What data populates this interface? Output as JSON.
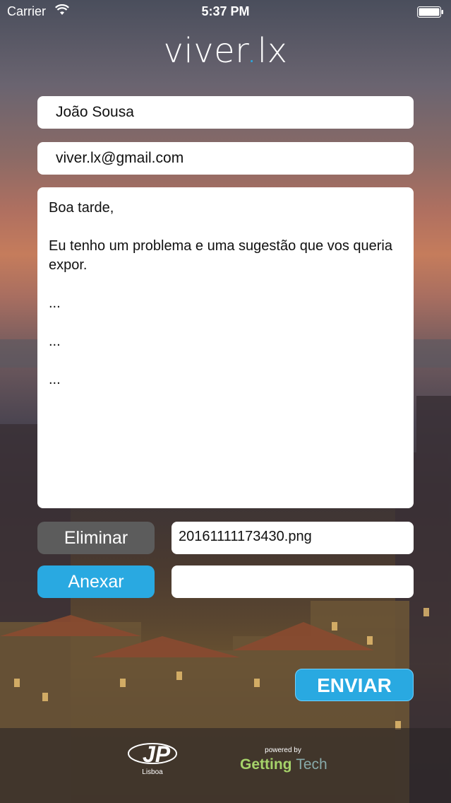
{
  "status_bar": {
    "carrier": "Carrier",
    "time": "5:37 PM"
  },
  "logo": {
    "part1": "viver",
    "dot": ".",
    "part2": "lx",
    "dot_color": "#29a9e1"
  },
  "form": {
    "name_value": "João Sousa",
    "email_value": "viver.lx@gmail.com",
    "message_lines": [
      "Boa tarde,",
      "",
      "Eu tenho um problema e uma sugestão que vos queria expor.",
      "",
      "...",
      "",
      "...",
      "",
      "..."
    ],
    "delete_label": "Eliminar",
    "attach_label": "Anexar",
    "attached_file": "20161111173430.png",
    "second_file": "",
    "send_label": "ENVIAR"
  },
  "footer": {
    "jp_caption": "Lisboa",
    "powered_by": "powered by",
    "getting": "Getting",
    "tech": "Tech"
  },
  "colors": {
    "accent": "#29a9e1",
    "delete_button": "#5c5c5c",
    "getting_green": "#a6d36a"
  }
}
